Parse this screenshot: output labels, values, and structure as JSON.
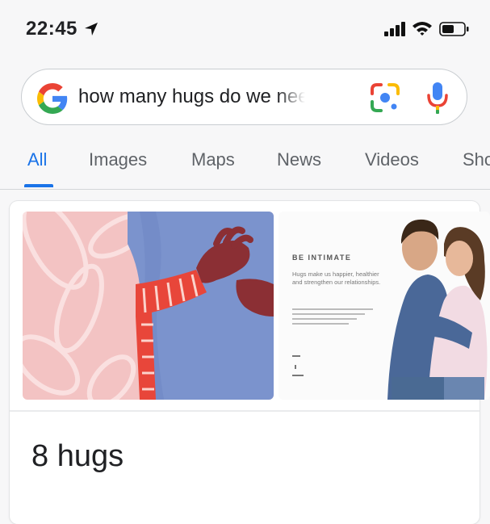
{
  "status_bar": {
    "time": "22:45",
    "icons": [
      "location-arrow-icon",
      "cellular-signal-icon",
      "wifi-icon",
      "battery-icon"
    ]
  },
  "search": {
    "query": "how many hugs do we need a...",
    "icons": [
      "google-logo-icon",
      "google-lens-icon",
      "microphone-icon"
    ]
  },
  "tabs": [
    {
      "label": "All",
      "active": true
    },
    {
      "label": "Images",
      "active": false
    },
    {
      "label": "Maps",
      "active": false
    },
    {
      "label": "News",
      "active": false
    },
    {
      "label": "Videos",
      "active": false
    },
    {
      "label": "Sho",
      "active": false
    }
  ],
  "result": {
    "images": [
      {
        "name": "hug-illustration"
      },
      {
        "name": "be-intimate-ad",
        "heading": "BE INTIMATE",
        "body": "Hugs make us happier, healthier and strengthen our relationships."
      }
    ],
    "answer": "8 hugs"
  },
  "colors": {
    "accent": "#1a73e8",
    "google_blue": "#4285F4",
    "google_red": "#EA4335",
    "google_yellow": "#FBBC05",
    "google_green": "#34A853"
  }
}
